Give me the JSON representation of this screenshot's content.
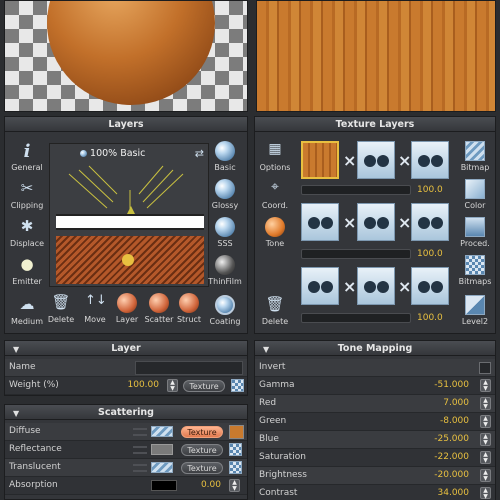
{
  "left_panel": {
    "layers_title": "Layers",
    "material_label": "100% Basic",
    "left_buttons": [
      "General",
      "Clipping",
      "Displace",
      "Emitter",
      "Medium"
    ],
    "right_buttons": [
      "Basic",
      "Glossy",
      "SSS",
      "ThinFilm",
      "Coating"
    ],
    "bottom_buttons": [
      "Delete",
      "Move",
      "Layer",
      "Scatter",
      "Struct"
    ]
  },
  "layer_section": {
    "title": "Layer",
    "name_label": "Name",
    "name_value": "",
    "weight_label": "Weight (%)",
    "weight_value": "100.00",
    "texture_label": "Texture"
  },
  "scattering": {
    "title": "Scattering",
    "rows": [
      {
        "label": "Diffuse",
        "texture": "Texture",
        "value": ""
      },
      {
        "label": "Reflectance",
        "texture": "Texture",
        "value": ""
      },
      {
        "label": "Translucent",
        "texture": "Texture",
        "value": ""
      },
      {
        "label": "Absorption",
        "texture": "",
        "value": "0.00"
      }
    ]
  },
  "right_panel": {
    "texture_layers_title": "Texture Layers",
    "left_buttons": [
      "Options",
      "Coord.",
      "Tone",
      "Delete"
    ],
    "right_buttons": [
      "Bitmap",
      "Color",
      "Proced.",
      "Bitmaps",
      "Level2"
    ],
    "bar_values": [
      "100.0",
      "100.0",
      "100.0"
    ]
  },
  "tone_mapping": {
    "title": "Tone Mapping",
    "rows": [
      {
        "label": "Invert",
        "value": ""
      },
      {
        "label": "Gamma",
        "value": "-51.000"
      },
      {
        "label": "Red",
        "value": "7.000"
      },
      {
        "label": "Green",
        "value": "-8.000"
      },
      {
        "label": "Blue",
        "value": "-25.000"
      },
      {
        "label": "Saturation",
        "value": "-22.000"
      },
      {
        "label": "Brightness",
        "value": "-20.000"
      },
      {
        "label": "Contrast",
        "value": "34.000"
      }
    ]
  },
  "colors": {
    "accent_orange": "#e07a4f",
    "value_yellow": "#e8c040",
    "wood": "#c97a2e"
  }
}
